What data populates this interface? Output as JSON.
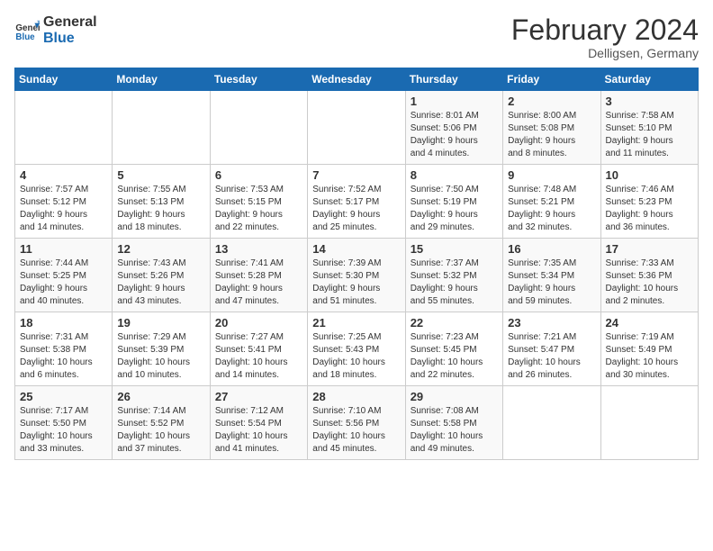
{
  "logo": {
    "line1": "General",
    "line2": "Blue"
  },
  "title": "February 2024",
  "subtitle": "Delligsen, Germany",
  "days_of_week": [
    "Sunday",
    "Monday",
    "Tuesday",
    "Wednesday",
    "Thursday",
    "Friday",
    "Saturday"
  ],
  "weeks": [
    [
      {
        "day": "",
        "info": ""
      },
      {
        "day": "",
        "info": ""
      },
      {
        "day": "",
        "info": ""
      },
      {
        "day": "",
        "info": ""
      },
      {
        "day": "1",
        "info": "Sunrise: 8:01 AM\nSunset: 5:06 PM\nDaylight: 9 hours\nand 4 minutes."
      },
      {
        "day": "2",
        "info": "Sunrise: 8:00 AM\nSunset: 5:08 PM\nDaylight: 9 hours\nand 8 minutes."
      },
      {
        "day": "3",
        "info": "Sunrise: 7:58 AM\nSunset: 5:10 PM\nDaylight: 9 hours\nand 11 minutes."
      }
    ],
    [
      {
        "day": "4",
        "info": "Sunrise: 7:57 AM\nSunset: 5:12 PM\nDaylight: 9 hours\nand 14 minutes."
      },
      {
        "day": "5",
        "info": "Sunrise: 7:55 AM\nSunset: 5:13 PM\nDaylight: 9 hours\nand 18 minutes."
      },
      {
        "day": "6",
        "info": "Sunrise: 7:53 AM\nSunset: 5:15 PM\nDaylight: 9 hours\nand 22 minutes."
      },
      {
        "day": "7",
        "info": "Sunrise: 7:52 AM\nSunset: 5:17 PM\nDaylight: 9 hours\nand 25 minutes."
      },
      {
        "day": "8",
        "info": "Sunrise: 7:50 AM\nSunset: 5:19 PM\nDaylight: 9 hours\nand 29 minutes."
      },
      {
        "day": "9",
        "info": "Sunrise: 7:48 AM\nSunset: 5:21 PM\nDaylight: 9 hours\nand 32 minutes."
      },
      {
        "day": "10",
        "info": "Sunrise: 7:46 AM\nSunset: 5:23 PM\nDaylight: 9 hours\nand 36 minutes."
      }
    ],
    [
      {
        "day": "11",
        "info": "Sunrise: 7:44 AM\nSunset: 5:25 PM\nDaylight: 9 hours\nand 40 minutes."
      },
      {
        "day": "12",
        "info": "Sunrise: 7:43 AM\nSunset: 5:26 PM\nDaylight: 9 hours\nand 43 minutes."
      },
      {
        "day": "13",
        "info": "Sunrise: 7:41 AM\nSunset: 5:28 PM\nDaylight: 9 hours\nand 47 minutes."
      },
      {
        "day": "14",
        "info": "Sunrise: 7:39 AM\nSunset: 5:30 PM\nDaylight: 9 hours\nand 51 minutes."
      },
      {
        "day": "15",
        "info": "Sunrise: 7:37 AM\nSunset: 5:32 PM\nDaylight: 9 hours\nand 55 minutes."
      },
      {
        "day": "16",
        "info": "Sunrise: 7:35 AM\nSunset: 5:34 PM\nDaylight: 9 hours\nand 59 minutes."
      },
      {
        "day": "17",
        "info": "Sunrise: 7:33 AM\nSunset: 5:36 PM\nDaylight: 10 hours\nand 2 minutes."
      }
    ],
    [
      {
        "day": "18",
        "info": "Sunrise: 7:31 AM\nSunset: 5:38 PM\nDaylight: 10 hours\nand 6 minutes."
      },
      {
        "day": "19",
        "info": "Sunrise: 7:29 AM\nSunset: 5:39 PM\nDaylight: 10 hours\nand 10 minutes."
      },
      {
        "day": "20",
        "info": "Sunrise: 7:27 AM\nSunset: 5:41 PM\nDaylight: 10 hours\nand 14 minutes."
      },
      {
        "day": "21",
        "info": "Sunrise: 7:25 AM\nSunset: 5:43 PM\nDaylight: 10 hours\nand 18 minutes."
      },
      {
        "day": "22",
        "info": "Sunrise: 7:23 AM\nSunset: 5:45 PM\nDaylight: 10 hours\nand 22 minutes."
      },
      {
        "day": "23",
        "info": "Sunrise: 7:21 AM\nSunset: 5:47 PM\nDaylight: 10 hours\nand 26 minutes."
      },
      {
        "day": "24",
        "info": "Sunrise: 7:19 AM\nSunset: 5:49 PM\nDaylight: 10 hours\nand 30 minutes."
      }
    ],
    [
      {
        "day": "25",
        "info": "Sunrise: 7:17 AM\nSunset: 5:50 PM\nDaylight: 10 hours\nand 33 minutes."
      },
      {
        "day": "26",
        "info": "Sunrise: 7:14 AM\nSunset: 5:52 PM\nDaylight: 10 hours\nand 37 minutes."
      },
      {
        "day": "27",
        "info": "Sunrise: 7:12 AM\nSunset: 5:54 PM\nDaylight: 10 hours\nand 41 minutes."
      },
      {
        "day": "28",
        "info": "Sunrise: 7:10 AM\nSunset: 5:56 PM\nDaylight: 10 hours\nand 45 minutes."
      },
      {
        "day": "29",
        "info": "Sunrise: 7:08 AM\nSunset: 5:58 PM\nDaylight: 10 hours\nand 49 minutes."
      },
      {
        "day": "",
        "info": ""
      },
      {
        "day": "",
        "info": ""
      }
    ]
  ]
}
